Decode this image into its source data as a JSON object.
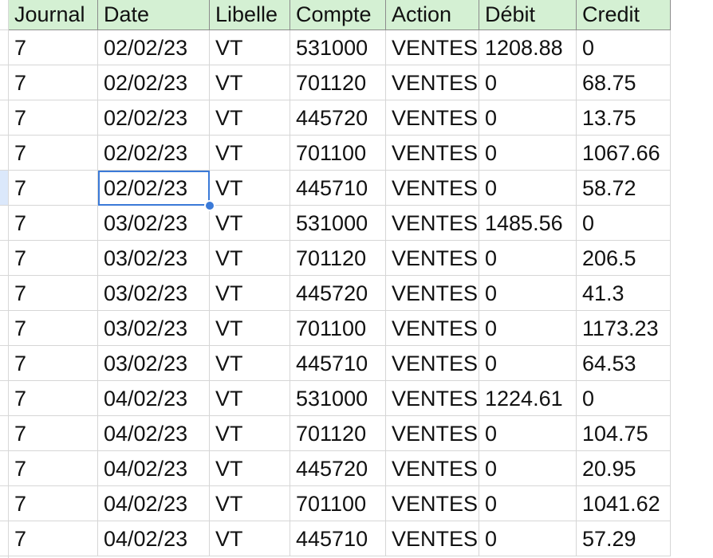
{
  "columns": [
    "Journal",
    "Date",
    "Libelle",
    "Compte",
    "Action",
    "Débit",
    "Credit"
  ],
  "rows": [
    [
      "7",
      "02/02/23",
      "VT",
      "531000",
      "VENTES",
      "1208.88",
      "0"
    ],
    [
      "7",
      "02/02/23",
      "VT",
      "701120",
      "VENTES",
      "0",
      "68.75"
    ],
    [
      "7",
      "02/02/23",
      "VT",
      "445720",
      "VENTES",
      "0",
      "13.75"
    ],
    [
      "7",
      "02/02/23",
      "VT",
      "701100",
      "VENTES",
      "0",
      "1067.66"
    ],
    [
      "7",
      "02/02/23",
      "VT",
      "445710",
      "VENTES",
      "0",
      "58.72"
    ],
    [
      "7",
      "03/02/23",
      "VT",
      "531000",
      "VENTES",
      "1485.56",
      "0"
    ],
    [
      "7",
      "03/02/23",
      "VT",
      "701120",
      "VENTES",
      "0",
      "206.5"
    ],
    [
      "7",
      "03/02/23",
      "VT",
      "445720",
      "VENTES",
      "0",
      "41.3"
    ],
    [
      "7",
      "03/02/23",
      "VT",
      "701100",
      "VENTES",
      "0",
      "1173.23"
    ],
    [
      "7",
      "03/02/23",
      "VT",
      "445710",
      "VENTES",
      "0",
      "64.53"
    ],
    [
      "7",
      "04/02/23",
      "VT",
      "531000",
      "VENTES",
      "1224.61",
      "0"
    ],
    [
      "7",
      "04/02/23",
      "VT",
      "701120",
      "VENTES",
      "0",
      "104.75"
    ],
    [
      "7",
      "04/02/23",
      "VT",
      "445720",
      "VENTES",
      "0",
      "20.95"
    ],
    [
      "7",
      "04/02/23",
      "VT",
      "701100",
      "VENTES",
      "0",
      "1041.62"
    ],
    [
      "7",
      "04/02/23",
      "VT",
      "445710",
      "VENTES",
      "0",
      "57.29"
    ]
  ],
  "colors": {
    "header_fill": "#d4f0d3",
    "selection": "#3b7ad8",
    "active_row_marker": "#dbe8fb"
  }
}
